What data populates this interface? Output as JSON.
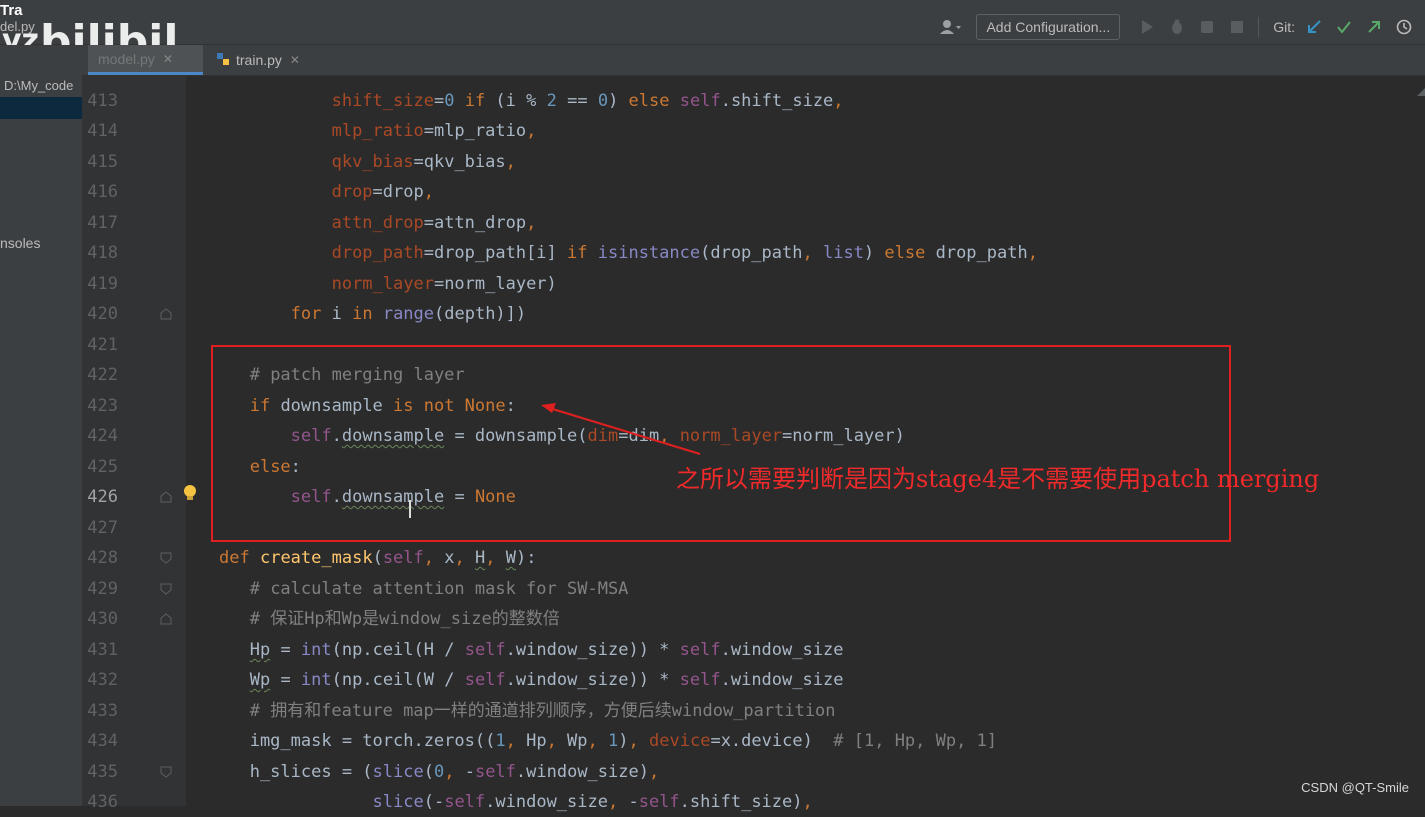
{
  "top": {
    "title": "Tra",
    "file": "del.py",
    "add_configuration": "Add Configuration...",
    "git_label": "Git:"
  },
  "side": {
    "path": "D:\\My_code",
    "consoles": "nsoles"
  },
  "tabs": [
    {
      "label": "model.py",
      "active": true
    },
    {
      "label": "train.py",
      "active": false
    }
  ],
  "lines": [
    {
      "n": "413"
    },
    {
      "n": "414"
    },
    {
      "n": "415"
    },
    {
      "n": "416"
    },
    {
      "n": "417"
    },
    {
      "n": "418"
    },
    {
      "n": "419"
    },
    {
      "n": "420"
    },
    {
      "n": "421"
    },
    {
      "n": "422"
    },
    {
      "n": "423"
    },
    {
      "n": "424"
    },
    {
      "n": "425"
    },
    {
      "n": "426"
    },
    {
      "n": "427"
    },
    {
      "n": "428"
    },
    {
      "n": "429"
    },
    {
      "n": "430"
    },
    {
      "n": "431"
    },
    {
      "n": "432"
    },
    {
      "n": "433"
    },
    {
      "n": "434"
    },
    {
      "n": "435"
    },
    {
      "n": "436"
    }
  ],
  "code": {
    "c422": "# patch merging layer",
    "c429": "# calculate attention mask for SW-MSA",
    "c430": "# 保证Hp和Wp是window_size的整数倍",
    "c433": "# 拥有和feature map一样的通道排列顺序，方便后续window_partition",
    "c434": "# [1, Hp, Wp, 1]"
  },
  "annotation": "之所以需要判断是因为stage4是不需要使用patch merging",
  "watermark": "CSDN @QT-Smile",
  "colors": {
    "keyword": "#cc7832",
    "number": "#6897bb",
    "self": "#94558d",
    "param": "#aa4926",
    "function": "#ffc66d",
    "comment": "#808080",
    "annotation": "#f02a2a"
  }
}
